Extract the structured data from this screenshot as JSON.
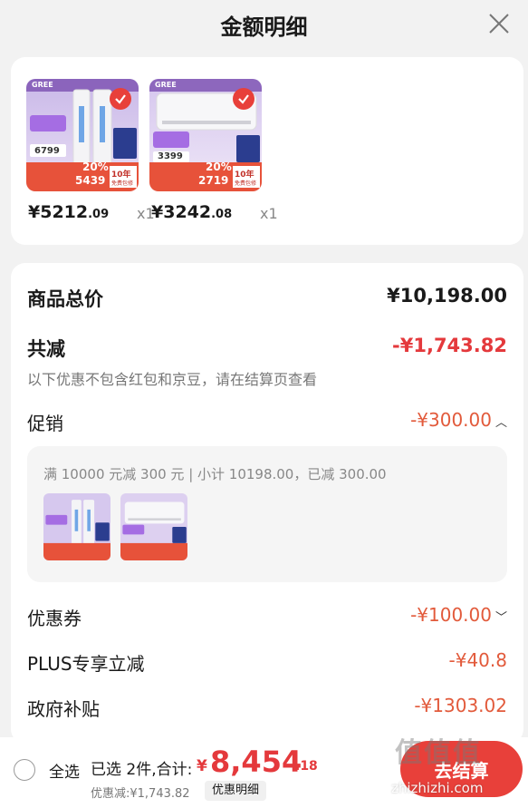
{
  "header": {
    "title": "金额明细"
  },
  "products": [
    {
      "price_int": "¥5212",
      "price_dec": ".09",
      "qty": "x1",
      "thumb": {
        "brand": "GREE",
        "price_tag": "6799",
        "promo_text": "20%",
        "bottom_price": "5439",
        "badge": "10年",
        "badge_sub": "免费包修"
      }
    },
    {
      "price_int": "¥3242",
      "price_dec": ".08",
      "qty": "x1",
      "thumb": {
        "brand": "GREE",
        "price_tag": "3399",
        "promo_text": "20%",
        "bottom_price": "2719",
        "badge": "10年",
        "badge_sub": "免费包修"
      }
    }
  ],
  "summary": {
    "total_label": "商品总价",
    "total_value": "¥10,198.00",
    "reduce_label": "共减",
    "reduce_value": "-¥1,743.82",
    "note": "以下优惠不包含红包和京豆，请在结算页查看",
    "promo_label": "促销",
    "promo_value": "-¥300.00",
    "promo_desc": "满 10000 元减 300 元 | 小计 10198.00，已减 300.00",
    "coupon_label": "优惠券",
    "coupon_value": "-¥100.00",
    "plus_label": "PLUS专享立减",
    "plus_value": "-¥40.8",
    "gov_label": "政府补贴",
    "gov_value": "-¥1303.02"
  },
  "bottom_bar": {
    "select_all": "全选",
    "selected_info": "已选 2件,合计:",
    "total_yen": "¥",
    "total_int": "8,454",
    "total_dec": ".18",
    "discount_line": "优惠减:¥1,743.82",
    "detail_link": "优惠明细",
    "checkout": "去结算"
  },
  "watermark": {
    "logo": "值值值",
    "url": "zhizhizhi.com"
  },
  "colors": {
    "accent_red": "#e4393c",
    "background": "#f2f2f2",
    "card": "#ffffff"
  }
}
